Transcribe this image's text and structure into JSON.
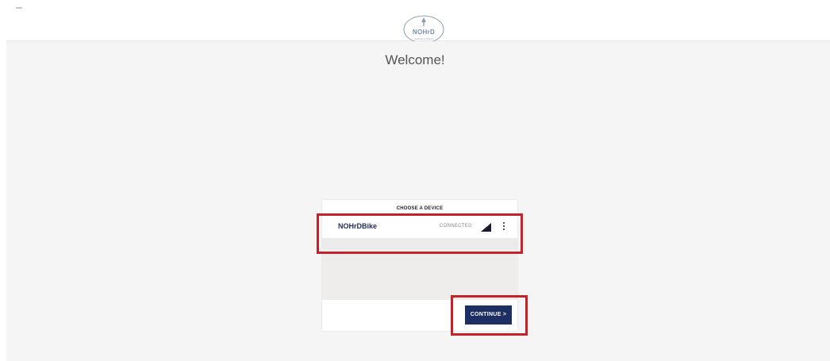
{
  "header": {
    "logo_text": "NOHrD",
    "logo_subtext": "SWEDE FITNESS"
  },
  "main": {
    "welcome_title": "Welcome!"
  },
  "device_chooser": {
    "title": "CHOOSE A DEVICE",
    "devices": [
      {
        "name": "NOHrDBike",
        "status": "CONNECTED",
        "signal_icon": "signal-strength-icon",
        "menu_icon": "more-vert-icon"
      }
    ],
    "continue_label": "CONTINUE >"
  },
  "colors": {
    "primary_button": "#1d2e63",
    "device_name": "#1f2d5a",
    "highlight": "#c8202b",
    "background": "#f5f5f5"
  }
}
